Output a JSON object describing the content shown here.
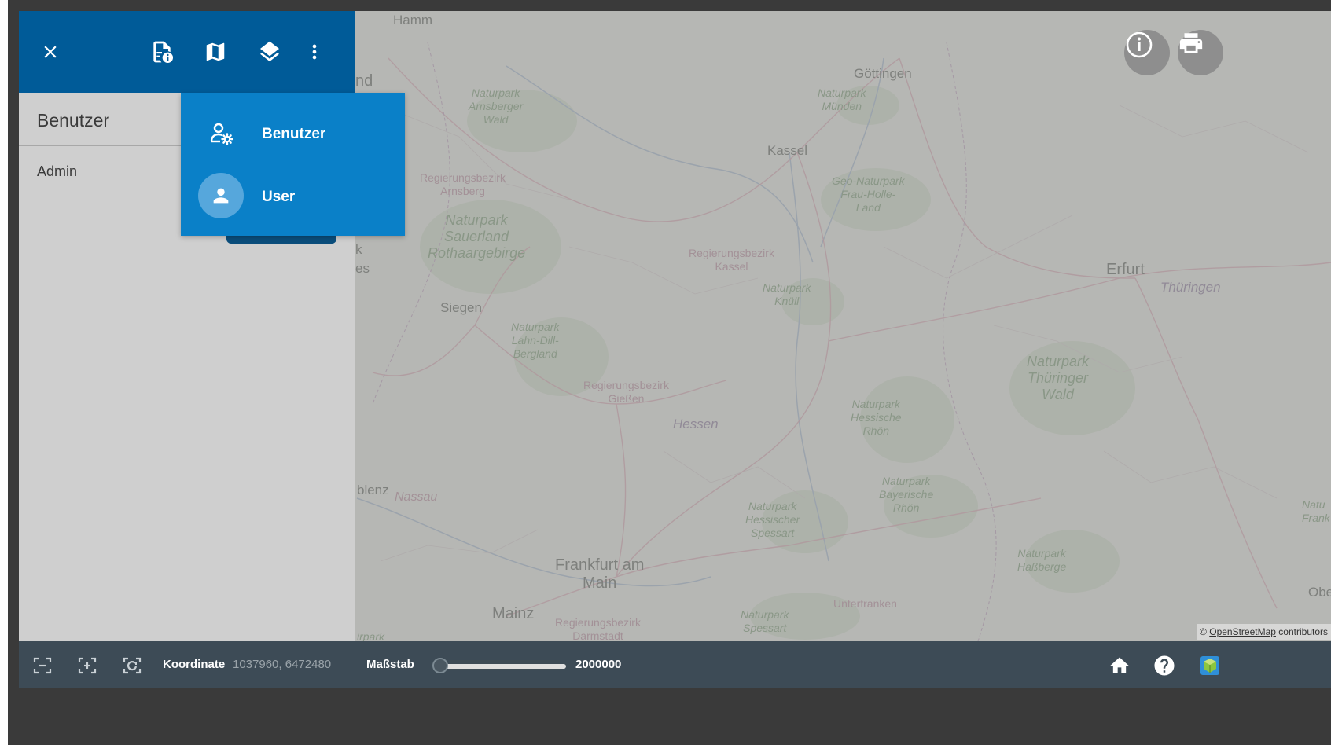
{
  "panel": {
    "title": "Benutzer",
    "items": [
      "Admin"
    ]
  },
  "toolbar": {
    "icons": [
      "close-icon",
      "document-info-icon",
      "map-icon",
      "layers-icon",
      "more-vert-icon"
    ]
  },
  "dropdown": {
    "items": [
      {
        "label": "Benutzer",
        "icon": "user-settings-icon"
      },
      {
        "label": "User",
        "icon": "person-icon"
      }
    ]
  },
  "map": {
    "labels": {
      "hamm": "Hamm",
      "nd": "nd",
      "goettingen": "Göttingen",
      "kassel": "Kassel",
      "erfurt": "Erfurt",
      "thueringen": "Thüringen",
      "siegen": "Siegen",
      "hessen": "Hessen",
      "frankfurt": "Frankfurt am\nMain",
      "mainz": "Mainz",
      "blenz": "blenz",
      "nassau": "Nassau",
      "k": "k",
      "es": "es",
      "irpark": "irpark",
      "obe": "Obe",
      "natu": "Natu\nFrank",
      "unterfranken": "Unterfranken",
      "np_arnsberger": "Naturpark\nArnsberger\nWald",
      "np_muenden": "Naturpark\nMünden",
      "np_frauholle": "Geo-Naturpark\nFrau-Holle-\nLand",
      "np_sauerland": "Naturpark\nSauerland\nRothaargebirge",
      "np_knuell": "Naturpark\nKnüll",
      "np_lahndill": "Naturpark\nLahn-Dill-\nBergland",
      "np_thueringerwald": "Naturpark\nThüringer\nWald",
      "np_hessrhoen": "Naturpark\nHessische\nRhön",
      "np_bayrhoen": "Naturpark\nBayerische\nRhön",
      "np_hessspessart": "Naturpark\nHessischer\nSpessart",
      "np_hassberge": "Naturpark\nHaßberge",
      "np_spessart": "Naturpark\nSpessart",
      "rb_arnsberg": "Regierungsbezirk\nArnsberg",
      "rb_kassel": "Regierungsbezirk\nKassel",
      "rb_giessen": "Regierungsbezirk\nGießen",
      "rb_darmstadt": "Regierungsbezirk\nDarmstadt"
    },
    "attribution_prefix": "©",
    "attribution_link": "OpenStreetMap",
    "attribution_suffix": "contributors",
    "buttons": [
      "info-icon",
      "print-icon"
    ]
  },
  "bottombar": {
    "coord_label": "Koordinate",
    "coord_value": "1037960, 6472480",
    "scale_label": "Maßstab",
    "scale_value": "2000000",
    "scale_slider_fraction": 0.0,
    "tools": [
      "zoom-extent-icon",
      "zoom-in-box-icon",
      "zoom-locate-icon"
    ],
    "right_icons": [
      "home-icon",
      "help-icon",
      "app-logo-icon"
    ]
  },
  "colors": {
    "toolbar": "#005b98",
    "dropdown": "#0a80c8",
    "bottombar": "#3d4b56"
  }
}
